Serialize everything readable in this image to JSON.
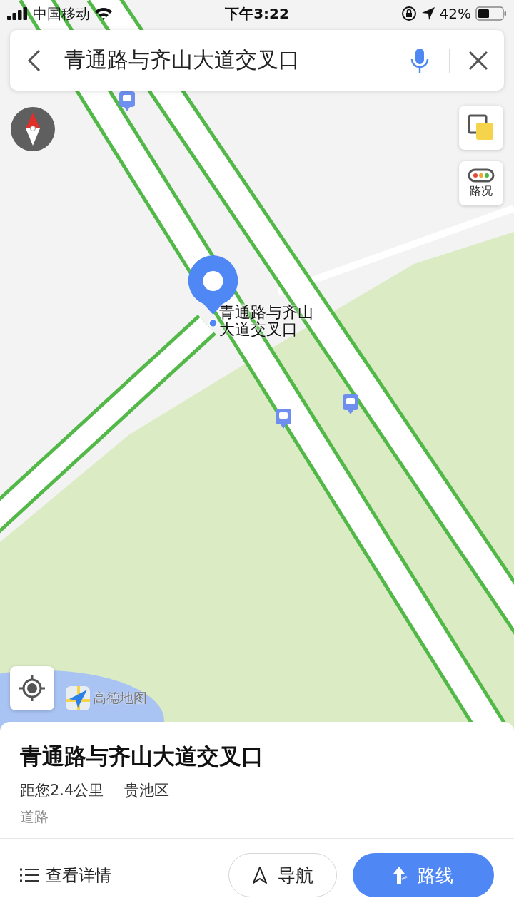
{
  "status_bar": {
    "carrier": "中国移动",
    "time": "下午3:22",
    "battery": "42%"
  },
  "search": {
    "value": "青通路与齐山大道交叉口"
  },
  "map": {
    "kind": "picture",
    "pin_label": "青通路与齐山大道交叉口",
    "traffic_label": "路况",
    "logo": "高德地图"
  },
  "place": {
    "name": "青通路与齐山大道交叉口",
    "distance": "距您2.4公里",
    "district": "贵池区",
    "category": "道路"
  },
  "actions": [
    {
      "kind": "details",
      "label": "查看详情"
    },
    {
      "kind": "navigate",
      "label": "导航"
    },
    {
      "kind": "route",
      "label": "路线"
    }
  ]
}
